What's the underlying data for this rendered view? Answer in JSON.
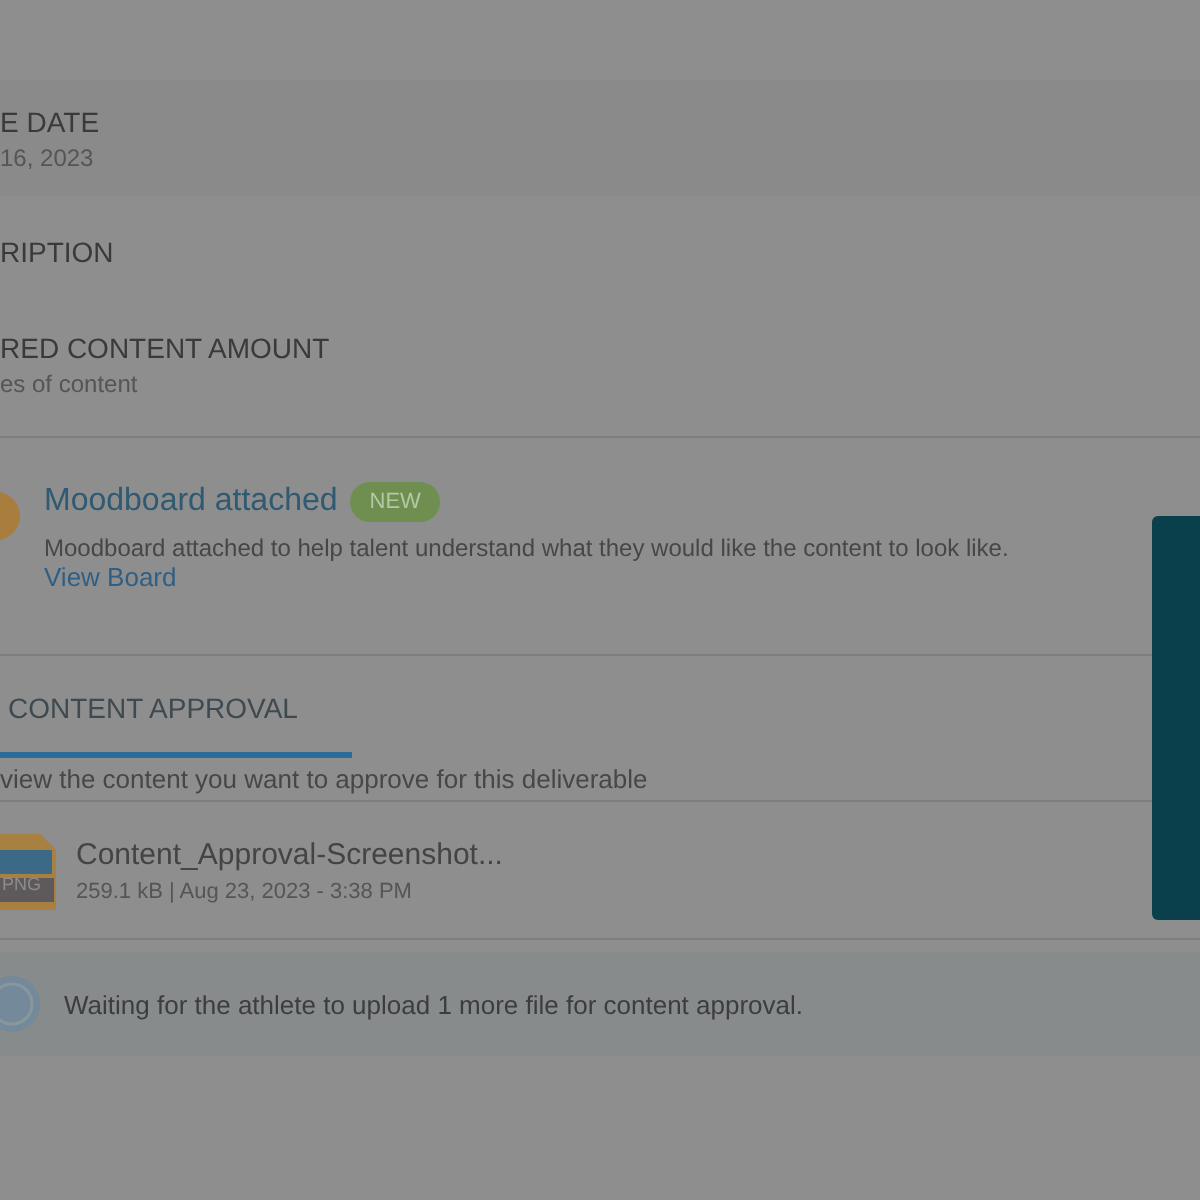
{
  "details": [
    {
      "label": "E DATE",
      "value": "16, 2023"
    },
    {
      "label": "RIPTION"
    },
    {
      "label": "RED CONTENT AMOUNT",
      "value": "es of content"
    }
  ],
  "moodboard": {
    "title": "Moodboard attached",
    "badge": "NEW",
    "description": "Moodboard attached to help talent understand what they would like the content to look like.",
    "link": "View Board"
  },
  "tabs": [
    {
      "label": "CONTENT APPROVAL",
      "selected": true
    }
  ],
  "instruction": "view the content you want to approve for this deliverable",
  "files": [
    {
      "type": "PNG",
      "name": "Content_Approval-Screenshot...",
      "meta": "259.1 kB | Aug 23, 2023 - 3:38 PM"
    }
  ],
  "notice": "Waiting for the athlete to upload 1 more file for content approval."
}
